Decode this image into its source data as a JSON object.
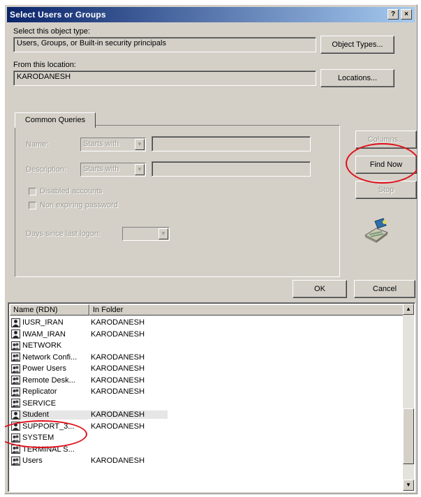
{
  "window": {
    "title": "Select Users or Groups",
    "help_btn": "?",
    "close_btn": "×"
  },
  "object_type": {
    "label": "Select this object type:",
    "value": "Users, Groups, or Built-in security principals",
    "button": "Object Types..."
  },
  "location": {
    "label": "From this location:",
    "value": "KARODANESH",
    "button": "Locations..."
  },
  "queries": {
    "tab": "Common Queries",
    "name_label": "Name:",
    "name_mode": "Starts with",
    "desc_label": "Description:",
    "desc_mode": "Starts with",
    "disabled_accounts": "Disabled accounts",
    "non_expiring": "Non expiring password",
    "days_label": "Days since last logon:"
  },
  "side_buttons": {
    "columns": "Columns...",
    "find_now": "Find Now",
    "stop": "Stop"
  },
  "actions": {
    "ok": "OK",
    "cancel": "Cancel"
  },
  "results": {
    "headers": [
      "Name (RDN)",
      "In Folder"
    ],
    "rows": [
      {
        "name": "IUSR_IRAN",
        "folder": "KARODANESH",
        "icon": "user-icon"
      },
      {
        "name": "IWAM_IRAN",
        "folder": "KARODANESH",
        "icon": "user-icon"
      },
      {
        "name": "NETWORK",
        "folder": "",
        "icon": "group-icon"
      },
      {
        "name": "Network Confi...",
        "folder": "KARODANESH",
        "icon": "group-icon"
      },
      {
        "name": "Power Users",
        "folder": "KARODANESH",
        "icon": "group-icon"
      },
      {
        "name": "Remote Desk...",
        "folder": "KARODANESH",
        "icon": "group-icon"
      },
      {
        "name": "Replicator",
        "folder": "KARODANESH",
        "icon": "group-icon"
      },
      {
        "name": "SERVICE",
        "folder": "",
        "icon": "group-icon"
      },
      {
        "name": "Student",
        "folder": "KARODANESH",
        "icon": "user-icon"
      },
      {
        "name": "SUPPORT_3...",
        "folder": "KARODANESH",
        "icon": "user-icon"
      },
      {
        "name": "SYSTEM",
        "folder": "",
        "icon": "group-icon"
      },
      {
        "name": "TERMINAL S...",
        "folder": "",
        "icon": "group-icon"
      },
      {
        "name": "Users",
        "folder": "KARODANESH",
        "icon": "group-icon"
      }
    ]
  },
  "colors": {
    "highlight_ring": "#e0101a",
    "title_bar": "#0a246a"
  }
}
